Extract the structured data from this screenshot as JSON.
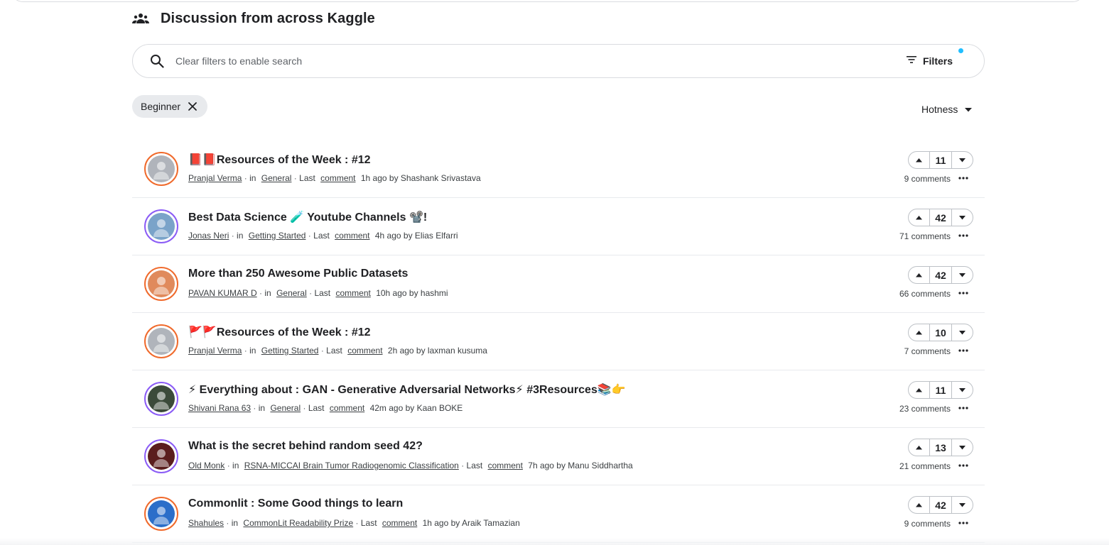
{
  "section": {
    "title": "Discussion from across Kaggle",
    "icon": "people-group-icon"
  },
  "search": {
    "placeholder": "Clear filters to enable search",
    "filters_label": "Filters",
    "filter_dot_color": "#20beff"
  },
  "chip": {
    "label": "Beginner"
  },
  "sort": {
    "label": "Hotness"
  },
  "colors": {
    "avatar_ring_orange": "#f06a2c",
    "avatar_ring_purple": "#8b5cf6",
    "divider": "#e8eaed"
  },
  "topics": [
    {
      "title": "📕📕Resources of the Week : #12",
      "author": "Pranjal Verma",
      "in_label": "in",
      "forum": "General",
      "last_label": "Last",
      "comment_link": "comment",
      "time_by": "1h ago by Shashank Srivastava",
      "votes": "11",
      "comments": "9 comments",
      "avatar_ring": "orange"
    },
    {
      "title": "Best Data Science 🧪 Youtube Channels 📽️!",
      "author": "Jonas Neri",
      "in_label": "in",
      "forum": "Getting Started",
      "last_label": "Last",
      "comment_link": "comment",
      "time_by": "4h ago by Elias Elfarri",
      "votes": "42",
      "comments": "71 comments",
      "avatar_ring": "purple"
    },
    {
      "title": "More than 250 Awesome Public Datasets",
      "author": "PAVAN KUMAR D",
      "in_label": "in",
      "forum": "General",
      "last_label": "Last",
      "comment_link": "comment",
      "time_by": "10h ago by hashmi",
      "votes": "42",
      "comments": "66 comments",
      "avatar_ring": "orange"
    },
    {
      "title": "🚩🚩Resources of the Week : #12",
      "author": "Pranjal Verma",
      "in_label": "in",
      "forum": "Getting Started",
      "last_label": "Last",
      "comment_link": "comment",
      "time_by": "2h ago by laxman kusuma",
      "votes": "10",
      "comments": "7 comments",
      "avatar_ring": "orange"
    },
    {
      "title": "⚡ Everything about : GAN - Generative Adversarial Networks⚡ #3Resources📚👉",
      "author": "Shivani Rana 63",
      "in_label": "in",
      "forum": "General",
      "last_label": "Last",
      "comment_link": "comment",
      "time_by": "42m ago by Kaan BOKE",
      "votes": "11",
      "comments": "23 comments",
      "avatar_ring": "purple"
    },
    {
      "title": "What is the secret behind random seed 42?",
      "author": "Old Monk",
      "in_label": "in",
      "forum": "RSNA-MICCAI Brain Tumor Radiogenomic Classification",
      "last_label": "Last",
      "comment_link": "comment",
      "time_by": "7h ago by Manu Siddhartha",
      "votes": "13",
      "comments": "21 comments",
      "avatar_ring": "purple"
    },
    {
      "title": "Commonlit : Some Good things to learn",
      "author": "Shahules",
      "in_label": "in",
      "forum": "CommonLit Readability Prize",
      "last_label": "Last",
      "comment_link": "comment",
      "time_by": "1h ago by Araik Tamazian",
      "votes": "42",
      "comments": "9 comments",
      "avatar_ring": "orange"
    }
  ]
}
